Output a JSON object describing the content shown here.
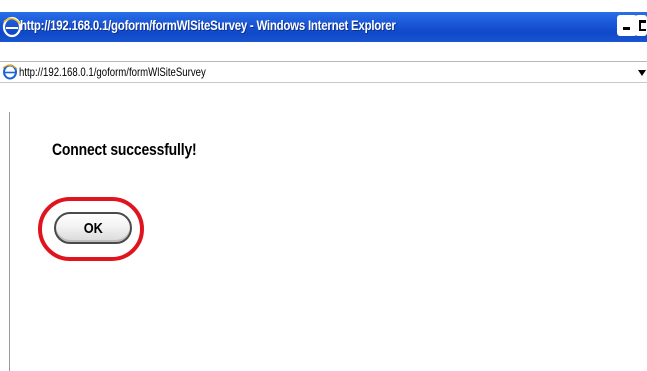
{
  "window": {
    "title": "http://192.168.0.1/goform/formWlSiteSurvey - Windows Internet Explorer",
    "colors": {
      "titlebar": "#1a56d6",
      "highlight_ring": "#e0141e"
    }
  },
  "address_bar": {
    "url": "http://192.168.0.1/goform/formWlSiteSurvey",
    "icon": "ie-page-icon"
  },
  "content": {
    "message": "Connect successfully!",
    "ok_button_label": "OK"
  }
}
